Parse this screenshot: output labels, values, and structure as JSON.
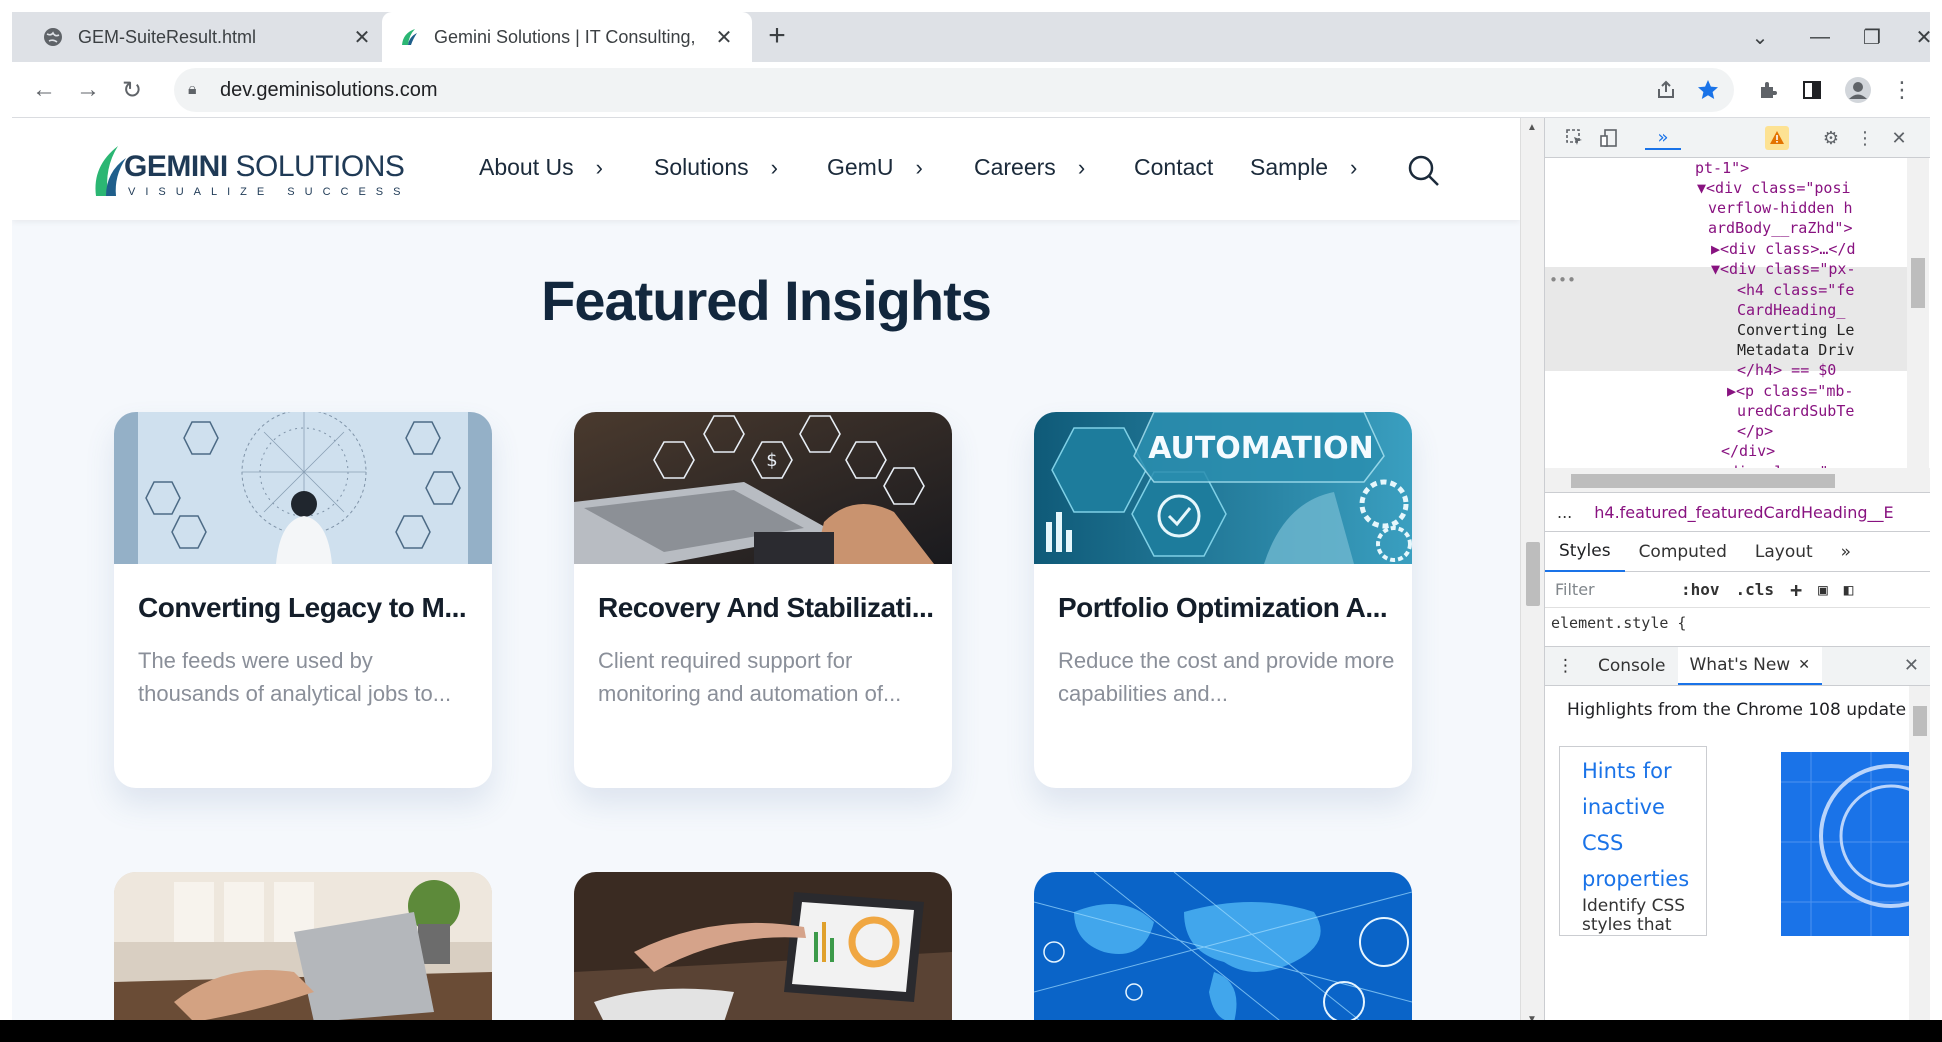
{
  "browser": {
    "tabs": [
      {
        "title": "GEM-SuiteResult.html",
        "active": false
      },
      {
        "title": "Gemini Solutions | IT Consulting,",
        "active": true
      }
    ],
    "new_tab_label": "+",
    "close_label": "✕",
    "url": "dev.geminisolutions.com"
  },
  "site": {
    "logo_text_bold": "GEMINI",
    "logo_text_light": " SOLUTIONS",
    "logo_tagline": "VISUALIZE SUCCESS",
    "nav": [
      {
        "label": "About Us",
        "has_chevron": true
      },
      {
        "label": "Solutions",
        "has_chevron": true
      },
      {
        "label": "GemU",
        "has_chevron": true
      },
      {
        "label": "Careers",
        "has_chevron": true
      },
      {
        "label": "Contact",
        "has_chevron": false
      },
      {
        "label": "Sample",
        "has_chevron": true
      }
    ],
    "heading": "Featured Insights",
    "cards": [
      {
        "title": "Converting Legacy to M...",
        "subtitle": "The feeds were used by thousands of analytical jobs to..."
      },
      {
        "title": "Recovery And Stabilizati...",
        "subtitle": "Client required support for monitoring and automation of..."
      },
      {
        "title": "Portfolio Optimization A...",
        "subtitle": "Reduce the cost and provide more capabilities and..."
      }
    ],
    "automation_text": "AUTOMATION"
  },
  "devtools": {
    "dom_lines": [
      {
        "text": "pt-1\">"
      },
      {
        "text": "▼<div class=\"posi"
      },
      {
        "text": "verflow-hidden h"
      },
      {
        "text": "ardBody__raZhd\">"
      },
      {
        "text": "▶<div class>…</d"
      },
      {
        "text": "▼<div class=\"px-"
      },
      {
        "text": "<h4 class=\"fe"
      },
      {
        "text": "CardHeading_"
      },
      {
        "text": "Converting Le"
      },
      {
        "text": "Metadata Driv"
      },
      {
        "text": "</h4> == $0"
      },
      {
        "text": "▶<p class=\"mb-"
      },
      {
        "text": "uredCardSubTe"
      },
      {
        "text": "</p>"
      },
      {
        "text": "</div>"
      },
      {
        "text": "▶<div class=\"pos"
      }
    ],
    "breadcrumb_dots": "...",
    "breadcrumb": "h4.featured_featuredCardHeading__E",
    "style_tabs": [
      "Styles",
      "Computed",
      "Layout",
      "»"
    ],
    "filter_placeholder": "Filter",
    "hov": ":hov",
    "cls": ".cls",
    "element_style": "element.style {",
    "drawer_tabs": [
      "Console",
      "What's New"
    ],
    "whats_new_title": "Highlights from the Chrome 108 update",
    "hint_link": "Hints for inactive CSS properties",
    "hint_desc": "Identify CSS styles that are entirely"
  },
  "colors": {
    "accent": "#1a73e8",
    "heading": "#12273d",
    "page_bg": "#f5f8fc"
  }
}
